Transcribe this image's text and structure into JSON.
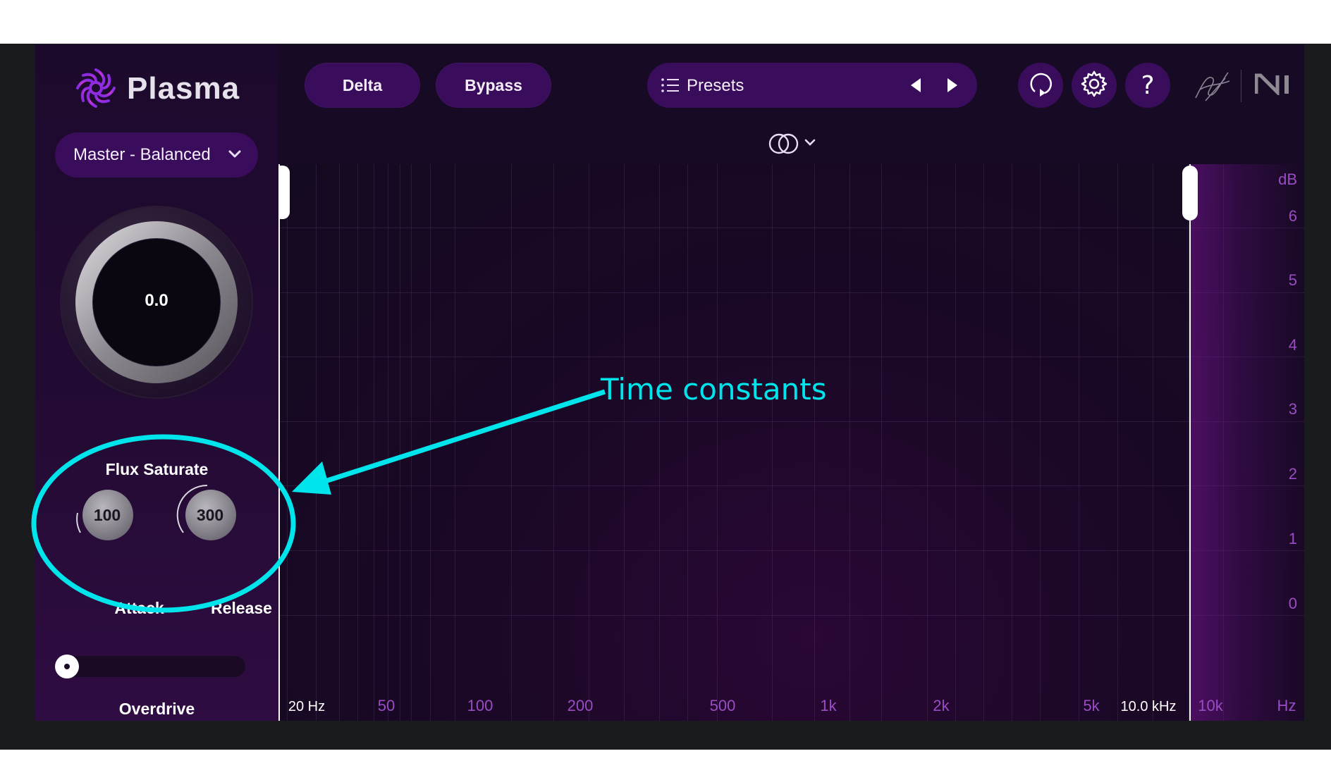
{
  "app": {
    "name": "Plasma"
  },
  "header": {
    "delta_label": "Delta",
    "bypass_label": "Bypass",
    "presets_label": "Presets"
  },
  "sidebar": {
    "preset_select": "Master - Balanced",
    "main_knob": {
      "value": "0.0",
      "label": "Flux Saturate"
    },
    "attack": {
      "value": "100",
      "label": "Attack"
    },
    "release": {
      "value": "300",
      "label": "Release"
    },
    "overdrive": {
      "label": "Overdrive",
      "level": 0
    }
  },
  "graph": {
    "x_ticks": [
      "20 Hz",
      "50",
      "100",
      "200",
      "500",
      "1k",
      "2k",
      "5k",
      "10.0 kHz",
      "10k",
      "Hz"
    ],
    "y_ticks": [
      "dB",
      "6",
      "5",
      "4",
      "3",
      "2",
      "1",
      "0"
    ]
  },
  "annotation": {
    "text": "Time constants"
  },
  "colors": {
    "accent": "#3a0c5c",
    "annotation": "#00e5ec",
    "tick": "#9a4cc4"
  },
  "icons": [
    "plasma-logo-icon",
    "list-icon",
    "arrow-left-icon",
    "arrow-right-icon",
    "undo-icon",
    "gear-icon",
    "help-icon",
    "signature-icon",
    "ni-logo-icon",
    "stereo-icon",
    "chevron-down-icon"
  ]
}
